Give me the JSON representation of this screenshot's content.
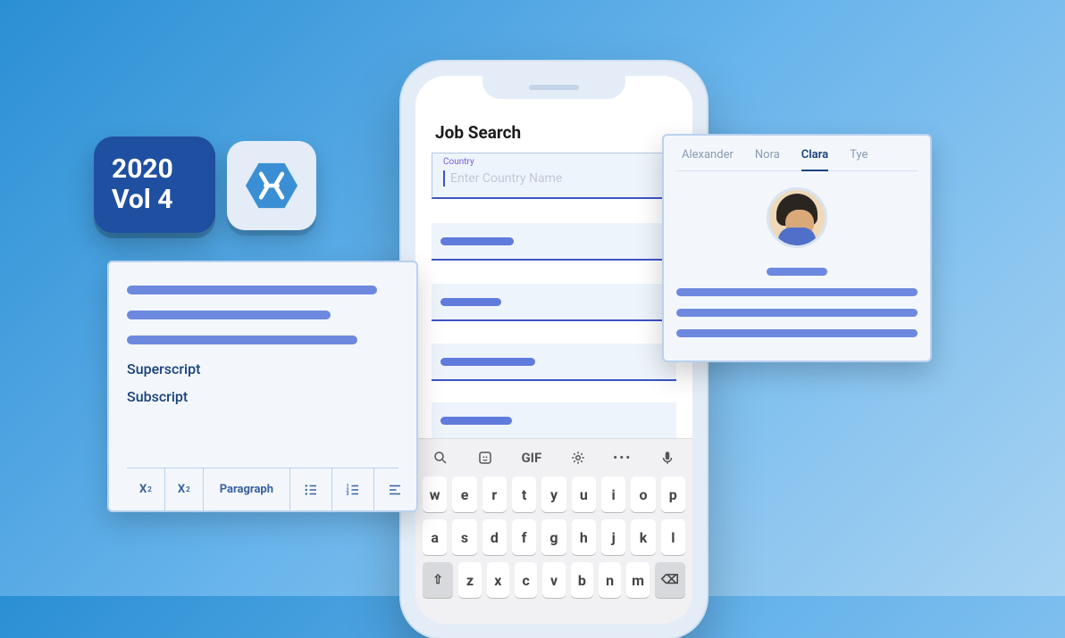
{
  "badge": {
    "line1": "2020",
    "line2": "Vol 4"
  },
  "phone": {
    "title": "Job Search",
    "field_label": "Country",
    "field_placeholder": "Enter Country Name"
  },
  "editor": {
    "item1": "Superscript",
    "item2": "Subscript",
    "sub_btn": "X",
    "sup_btn": "X",
    "para_btn": "Paragraph"
  },
  "tabs": {
    "t1": "Alexander",
    "t2": "Nora",
    "t3": "Clara",
    "t4": "Tye"
  },
  "keyboard": {
    "gif": "GIF",
    "row1": [
      "w",
      "e",
      "r",
      "t",
      "y",
      "u",
      "i",
      "o",
      "p"
    ],
    "row2": [
      "a",
      "s",
      "d",
      "f",
      "g",
      "h",
      "j",
      "k",
      "l"
    ],
    "row3": [
      "z",
      "x",
      "c",
      "v",
      "b",
      "n",
      "m"
    ]
  }
}
